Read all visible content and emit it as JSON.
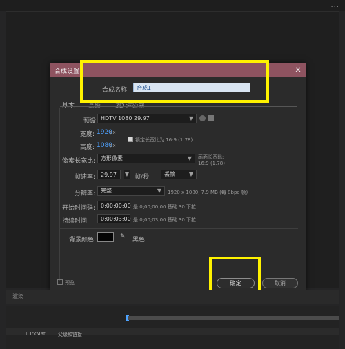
{
  "window": {
    "topbar_dots": "..."
  },
  "dialog": {
    "title": "合成设置",
    "composition_name_label": "合成名称:",
    "composition_name_value": "合成1",
    "tabs": [
      "基本",
      "高级",
      "3D 渲染器"
    ],
    "preset_label": "预设:",
    "preset_value": "HDTV 1080 29.97",
    "width_label": "宽度:",
    "width_value": "1920",
    "height_label": "高度:",
    "height_value": "1080",
    "px_unit": "px",
    "lock_aspect_label": "锁定长宽比为 16:9 (1.78)",
    "pixel_aspect_label": "像素长宽比:",
    "pixel_aspect_value": "方形像素",
    "frame_aspect_label": "画面长宽比:",
    "frame_aspect_value": "16:9 (1.78)",
    "frame_rate_label": "帧速率:",
    "frame_rate_value": "29.97",
    "frame_rate_unit": "帧/秒",
    "drop_frame_value": "丢帧",
    "resolution_label": "分辨率:",
    "resolution_value": "完整",
    "resolution_info": "1920 x 1080, 7.9 MB (每 8bpc 帧)",
    "start_timecode_label": "开始时间码:",
    "start_timecode_value": "0;00;00;00",
    "start_timecode_info": "是 0;00;00;00  基础 30 下拉",
    "duration_label": "持续时间:",
    "duration_value": "0;00;03;00",
    "duration_info": "是 0;00;03;00  基础 30 下拉",
    "background_color_label": "背景颜色:",
    "background_color_name": "黑色",
    "preview_label": "预览",
    "ok_label": "确定",
    "cancel_label": "取消"
  },
  "panel": {
    "lower_label": "渲染",
    "track_left_label": "T TrkMat",
    "track_parent_label": "父级和链接"
  },
  "colors": {
    "dialog_title_bg": "#8e5360",
    "highlight": "#fff200",
    "accent_blue": "#4ea1ff"
  }
}
